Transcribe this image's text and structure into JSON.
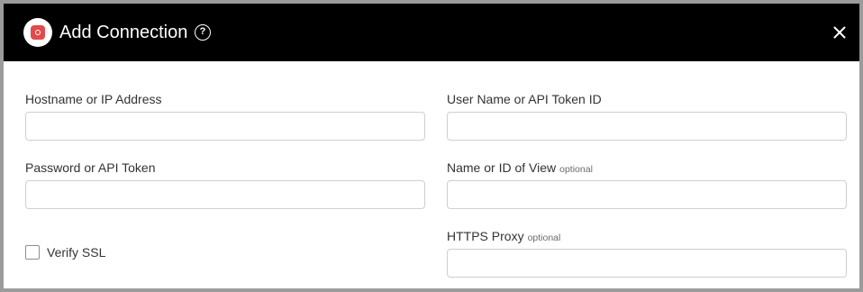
{
  "header": {
    "title": "Add Connection",
    "help_symbol": "?",
    "logo_icon": "app-logo-icon",
    "close_icon": "close-icon"
  },
  "form": {
    "hostname": {
      "label": "Hostname or IP Address",
      "value": "",
      "placeholder": ""
    },
    "username": {
      "label": "User Name or API Token ID",
      "value": "",
      "placeholder": ""
    },
    "password": {
      "label": "Password or API Token",
      "value": "",
      "placeholder": ""
    },
    "view": {
      "label": "Name or ID of View",
      "optional": "optional",
      "value": "",
      "placeholder": ""
    },
    "proxy": {
      "label": "HTTPS Proxy",
      "optional": "optional",
      "value": "",
      "placeholder": ""
    },
    "verify_ssl": {
      "label": "Verify SSL",
      "checked": false
    }
  },
  "colors": {
    "header_bg": "#000000",
    "logo_accent": "#e24b4b",
    "input_border": "#cfcfcf"
  }
}
